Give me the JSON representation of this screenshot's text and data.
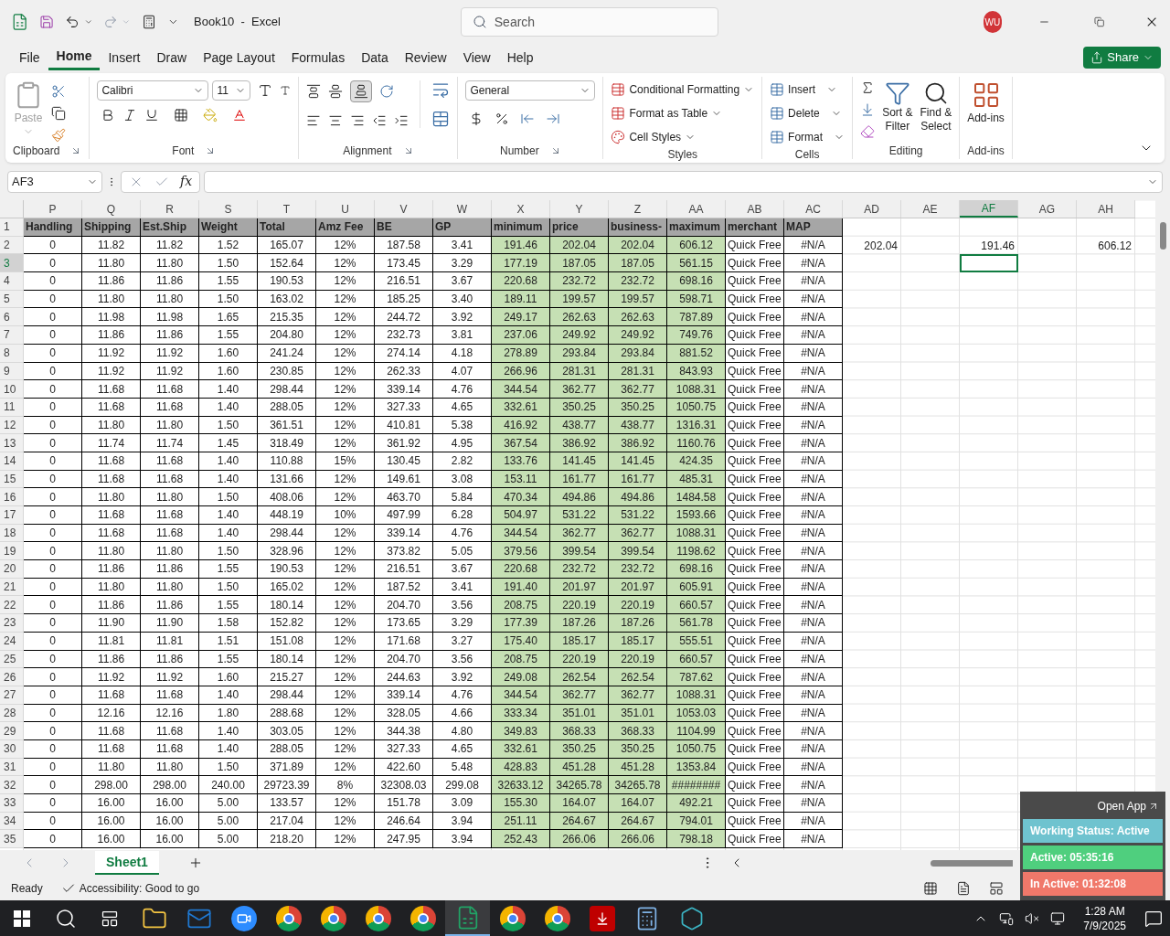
{
  "title_bar": {
    "title": "Book10  -  Excel",
    "search_placeholder": "Search",
    "avatar": "WU"
  },
  "menu_tabs": [
    {
      "label": "File",
      "selected": false
    },
    {
      "label": "Home",
      "selected": true
    },
    {
      "label": "Insert",
      "selected": false
    },
    {
      "label": "Draw",
      "selected": false
    },
    {
      "label": "Page Layout",
      "selected": false
    },
    {
      "label": "Formulas",
      "selected": false
    },
    {
      "label": "Data",
      "selected": false
    },
    {
      "label": "Review",
      "selected": false
    },
    {
      "label": "View",
      "selected": false
    },
    {
      "label": "Help",
      "selected": false
    }
  ],
  "share": "Share",
  "ribbon": {
    "groups": [
      "Clipboard",
      "Font",
      "Alignment",
      "Number",
      "Styles",
      "Cells",
      "Editing",
      "Add-ins"
    ],
    "paste": {
      "label": "Paste",
      "disabled": true
    },
    "font": "Calibri",
    "size": "11",
    "align_bottom": {
      "selected": true
    },
    "number_format": "General",
    "styles": [
      "Conditional Formatting",
      "Format as Table",
      "Cell Styles"
    ],
    "cells": [
      "Insert",
      "Delete",
      "Format"
    ],
    "sort": [
      "Sort &",
      "Filter"
    ],
    "find": [
      "Find &",
      "Select"
    ],
    "addins": "Add-ins"
  },
  "formula_bar": {
    "name_box": "AF3",
    "function_label": "fx"
  },
  "sheet": {
    "columns": [
      {
        "letter": "P",
        "highlight": false,
        "selected": false
      },
      {
        "letter": "Q",
        "highlight": false,
        "selected": false
      },
      {
        "letter": "R",
        "highlight": false,
        "selected": false
      },
      {
        "letter": "S",
        "highlight": false,
        "selected": false
      },
      {
        "letter": "T",
        "highlight": false,
        "selected": false
      },
      {
        "letter": "U",
        "highlight": false,
        "selected": false
      },
      {
        "letter": "V",
        "highlight": false,
        "selected": false
      },
      {
        "letter": "W",
        "highlight": false,
        "selected": false
      },
      {
        "letter": "X",
        "highlight": true,
        "selected": false
      },
      {
        "letter": "Y",
        "highlight": true,
        "selected": false
      },
      {
        "letter": "Z",
        "highlight": true,
        "selected": false
      },
      {
        "letter": "AA",
        "highlight": true,
        "selected": false
      },
      {
        "letter": "AB",
        "highlight": false,
        "selected": false
      },
      {
        "letter": "AC",
        "highlight": false,
        "selected": false
      },
      {
        "letter": "AD",
        "selected": false
      },
      {
        "letter": "AE",
        "selected": false
      },
      {
        "letter": "AF",
        "selected": true
      },
      {
        "letter": "AG",
        "selected": false
      },
      {
        "letter": "AH",
        "selected": false
      }
    ],
    "rows": [
      {
        "number": "1",
        "kind": "header",
        "cells": [
          "Handling",
          "Shipping",
          "Est.Ship",
          "Weight",
          "Total",
          "Amz Fee",
          "BE",
          "GP",
          "minimum",
          "price",
          "business-",
          "maximum",
          "merchant",
          "MAP"
        ]
      },
      {
        "number": "2",
        "kind": "data",
        "cells": [
          "0",
          "11.82",
          "11.82",
          "1.52",
          "165.07",
          "12%",
          "187.58",
          "3.41",
          "191.46",
          "202.04",
          "202.04",
          "606.12",
          "Quick Free",
          "#N/A"
        ],
        "extra": {
          "AD": "202.04",
          "AF": "191.46",
          "AH": "606.12"
        }
      },
      {
        "number": "3",
        "kind": "data",
        "selected": true,
        "cells": [
          "0",
          "11.80",
          "11.80",
          "1.50",
          "152.64",
          "12%",
          "173.45",
          "3.29",
          "177.19",
          "187.05",
          "187.05",
          "561.15",
          "Quick Free",
          "#N/A"
        ]
      },
      {
        "number": "4",
        "kind": "data",
        "cells": [
          "0",
          "11.86",
          "11.86",
          "1.55",
          "190.53",
          "12%",
          "216.51",
          "3.67",
          "220.68",
          "232.72",
          "232.72",
          "698.16",
          "Quick Free",
          "#N/A"
        ]
      },
      {
        "number": "5",
        "kind": "data",
        "cells": [
          "0",
          "11.80",
          "11.80",
          "1.50",
          "163.02",
          "12%",
          "185.25",
          "3.40",
          "189.11",
          "199.57",
          "199.57",
          "598.71",
          "Quick Free",
          "#N/A"
        ]
      },
      {
        "number": "6",
        "kind": "data",
        "cells": [
          "0",
          "11.98",
          "11.98",
          "1.65",
          "215.35",
          "12%",
          "244.72",
          "3.92",
          "249.17",
          "262.63",
          "262.63",
          "787.89",
          "Quick Free",
          "#N/A"
        ]
      },
      {
        "number": "7",
        "kind": "data",
        "cells": [
          "0",
          "11.86",
          "11.86",
          "1.55",
          "204.80",
          "12%",
          "232.73",
          "3.81",
          "237.06",
          "249.92",
          "249.92",
          "749.76",
          "Quick Free",
          "#N/A"
        ]
      },
      {
        "number": "8",
        "kind": "data",
        "cells": [
          "0",
          "11.92",
          "11.92",
          "1.60",
          "241.24",
          "12%",
          "274.14",
          "4.18",
          "278.89",
          "293.84",
          "293.84",
          "881.52",
          "Quick Free",
          "#N/A"
        ]
      },
      {
        "number": "9",
        "kind": "data",
        "cells": [
          "0",
          "11.92",
          "11.92",
          "1.60",
          "230.85",
          "12%",
          "262.33",
          "4.07",
          "266.96",
          "281.31",
          "281.31",
          "843.93",
          "Quick Free",
          "#N/A"
        ]
      },
      {
        "number": "10",
        "kind": "data",
        "cells": [
          "0",
          "11.68",
          "11.68",
          "1.40",
          "298.44",
          "12%",
          "339.14",
          "4.76",
          "344.54",
          "362.77",
          "362.77",
          "1088.31",
          "Quick Free",
          "#N/A"
        ]
      },
      {
        "number": "11",
        "kind": "data",
        "cells": [
          "0",
          "11.68",
          "11.68",
          "1.40",
          "288.05",
          "12%",
          "327.33",
          "4.65",
          "332.61",
          "350.25",
          "350.25",
          "1050.75",
          "Quick Free",
          "#N/A"
        ]
      },
      {
        "number": "12",
        "kind": "data",
        "cells": [
          "0",
          "11.80",
          "11.80",
          "1.50",
          "361.51",
          "12%",
          "410.81",
          "5.38",
          "416.92",
          "438.77",
          "438.77",
          "1316.31",
          "Quick Free",
          "#N/A"
        ]
      },
      {
        "number": "13",
        "kind": "data",
        "cells": [
          "0",
          "11.74",
          "11.74",
          "1.45",
          "318.49",
          "12%",
          "361.92",
          "4.95",
          "367.54",
          "386.92",
          "386.92",
          "1160.76",
          "Quick Free",
          "#N/A"
        ]
      },
      {
        "number": "14",
        "kind": "data",
        "cells": [
          "0",
          "11.68",
          "11.68",
          "1.40",
          "110.88",
          "15%",
          "130.45",
          "2.82",
          "133.76",
          "141.45",
          "141.45",
          "424.35",
          "Quick Free",
          "#N/A"
        ]
      },
      {
        "number": "15",
        "kind": "data",
        "cells": [
          "0",
          "11.68",
          "11.68",
          "1.40",
          "131.66",
          "12%",
          "149.61",
          "3.08",
          "153.11",
          "161.77",
          "161.77",
          "485.31",
          "Quick Free",
          "#N/A"
        ]
      },
      {
        "number": "16",
        "kind": "data",
        "cells": [
          "0",
          "11.80",
          "11.80",
          "1.50",
          "408.06",
          "12%",
          "463.70",
          "5.84",
          "470.34",
          "494.86",
          "494.86",
          "1484.58",
          "Quick Free",
          "#N/A"
        ]
      },
      {
        "number": "17",
        "kind": "data",
        "cells": [
          "0",
          "11.68",
          "11.68",
          "1.40",
          "448.19",
          "10%",
          "497.99",
          "6.28",
          "504.97",
          "531.22",
          "531.22",
          "1593.66",
          "Quick Free",
          "#N/A"
        ]
      },
      {
        "number": "18",
        "kind": "data",
        "cells": [
          "0",
          "11.68",
          "11.68",
          "1.40",
          "298.44",
          "12%",
          "339.14",
          "4.76",
          "344.54",
          "362.77",
          "362.77",
          "1088.31",
          "Quick Free",
          "#N/A"
        ]
      },
      {
        "number": "19",
        "kind": "data",
        "cells": [
          "0",
          "11.80",
          "11.80",
          "1.50",
          "328.96",
          "12%",
          "373.82",
          "5.05",
          "379.56",
          "399.54",
          "399.54",
          "1198.62",
          "Quick Free",
          "#N/A"
        ]
      },
      {
        "number": "20",
        "kind": "data",
        "cells": [
          "0",
          "11.86",
          "11.86",
          "1.55",
          "190.53",
          "12%",
          "216.51",
          "3.67",
          "220.68",
          "232.72",
          "232.72",
          "698.16",
          "Quick Free",
          "#N/A"
        ]
      },
      {
        "number": "21",
        "kind": "data",
        "cells": [
          "0",
          "11.80",
          "11.80",
          "1.50",
          "165.02",
          "12%",
          "187.52",
          "3.41",
          "191.40",
          "201.97",
          "201.97",
          "605.91",
          "Quick Free",
          "#N/A"
        ]
      },
      {
        "number": "22",
        "kind": "data",
        "cells": [
          "0",
          "11.86",
          "11.86",
          "1.55",
          "180.14",
          "12%",
          "204.70",
          "3.56",
          "208.75",
          "220.19",
          "220.19",
          "660.57",
          "Quick Free",
          "#N/A"
        ]
      },
      {
        "number": "23",
        "kind": "data",
        "cells": [
          "0",
          "11.90",
          "11.90",
          "1.58",
          "152.82",
          "12%",
          "173.65",
          "3.29",
          "177.39",
          "187.26",
          "187.26",
          "561.78",
          "Quick Free",
          "#N/A"
        ]
      },
      {
        "number": "24",
        "kind": "data",
        "cells": [
          "0",
          "11.81",
          "11.81",
          "1.51",
          "151.08",
          "12%",
          "171.68",
          "3.27",
          "175.40",
          "185.17",
          "185.17",
          "555.51",
          "Quick Free",
          "#N/A"
        ]
      },
      {
        "number": "25",
        "kind": "data",
        "cells": [
          "0",
          "11.86",
          "11.86",
          "1.55",
          "180.14",
          "12%",
          "204.70",
          "3.56",
          "208.75",
          "220.19",
          "220.19",
          "660.57",
          "Quick Free",
          "#N/A"
        ]
      },
      {
        "number": "26",
        "kind": "data",
        "cells": [
          "0",
          "11.92",
          "11.92",
          "1.60",
          "215.27",
          "12%",
          "244.63",
          "3.92",
          "249.08",
          "262.54",
          "262.54",
          "787.62",
          "Quick Free",
          "#N/A"
        ]
      },
      {
        "number": "27",
        "kind": "data",
        "cells": [
          "0",
          "11.68",
          "11.68",
          "1.40",
          "298.44",
          "12%",
          "339.14",
          "4.76",
          "344.54",
          "362.77",
          "362.77",
          "1088.31",
          "Quick Free",
          "#N/A"
        ]
      },
      {
        "number": "28",
        "kind": "data",
        "cells": [
          "0",
          "12.16",
          "12.16",
          "1.80",
          "288.68",
          "12%",
          "328.05",
          "4.66",
          "333.34",
          "351.01",
          "351.01",
          "1053.03",
          "Quick Free",
          "#N/A"
        ]
      },
      {
        "number": "29",
        "kind": "data",
        "cells": [
          "0",
          "11.68",
          "11.68",
          "1.40",
          "303.05",
          "12%",
          "344.38",
          "4.80",
          "349.83",
          "368.33",
          "368.33",
          "1104.99",
          "Quick Free",
          "#N/A"
        ]
      },
      {
        "number": "30",
        "kind": "data",
        "cells": [
          "0",
          "11.68",
          "11.68",
          "1.40",
          "288.05",
          "12%",
          "327.33",
          "4.65",
          "332.61",
          "350.25",
          "350.25",
          "1050.75",
          "Quick Free",
          "#N/A"
        ]
      },
      {
        "number": "31",
        "kind": "data",
        "cells": [
          "0",
          "11.80",
          "11.80",
          "1.50",
          "371.89",
          "12%",
          "422.60",
          "5.48",
          "428.83",
          "451.28",
          "451.28",
          "1353.84",
          "Quick Free",
          "#N/A"
        ]
      },
      {
        "number": "32",
        "kind": "data",
        "cells": [
          "0",
          "298.00",
          "298.00",
          "240.00",
          "29723.39",
          "8%",
          "32308.03",
          "299.08",
          "32633.12",
          "34265.78",
          "34265.78",
          "########",
          "Quick Free",
          "#N/A"
        ]
      },
      {
        "number": "33",
        "kind": "data",
        "cells": [
          "0",
          "16.00",
          "16.00",
          "5.00",
          "133.57",
          "12%",
          "151.78",
          "3.09",
          "155.30",
          "164.07",
          "164.07",
          "492.21",
          "Quick Free",
          "#N/A"
        ]
      },
      {
        "number": "34",
        "kind": "data",
        "cells": [
          "0",
          "16.00",
          "16.00",
          "5.00",
          "217.04",
          "12%",
          "246.64",
          "3.94",
          "251.11",
          "264.67",
          "264.67",
          "794.01",
          "Quick Free",
          "#N/A"
        ]
      },
      {
        "number": "35",
        "kind": "data",
        "cells": [
          "0",
          "16.00",
          "16.00",
          "5.00",
          "218.20",
          "12%",
          "247.95",
          "3.94",
          "252.43",
          "266.06",
          "266.06",
          "798.18",
          "Quick Free",
          "#N/A"
        ]
      }
    ]
  },
  "sheet_tabs": [
    {
      "label": "Sheet1",
      "selected": true
    }
  ],
  "status_bar": {
    "mode": "Ready",
    "accessibility": "Accessibility: Good to go"
  },
  "tracker": {
    "open_app": "Open App",
    "status": "Working Status: Active",
    "active": "Active: 05:35:16",
    "inactive": "In Active: 01:32:08"
  },
  "taskbar": {
    "apps": [
      {
        "kind": "folder",
        "active": false
      },
      {
        "kind": "mail",
        "active": false
      },
      {
        "kind": "video",
        "active": false
      },
      {
        "kind": "browser",
        "active": false
      },
      {
        "kind": "browser",
        "active": false
      },
      {
        "kind": "browser",
        "active": false
      },
      {
        "kind": "browser",
        "active": false
      },
      {
        "kind": "spreadsheet",
        "active": true
      },
      {
        "kind": "browser",
        "active": false
      },
      {
        "kind": "browser",
        "active": false
      },
      {
        "kind": "ftp",
        "active": false
      },
      {
        "kind": "calculator",
        "active": false
      },
      {
        "kind": "hexagon",
        "active": false
      }
    ],
    "time": "1:28 AM",
    "date": "7/9/2025"
  }
}
